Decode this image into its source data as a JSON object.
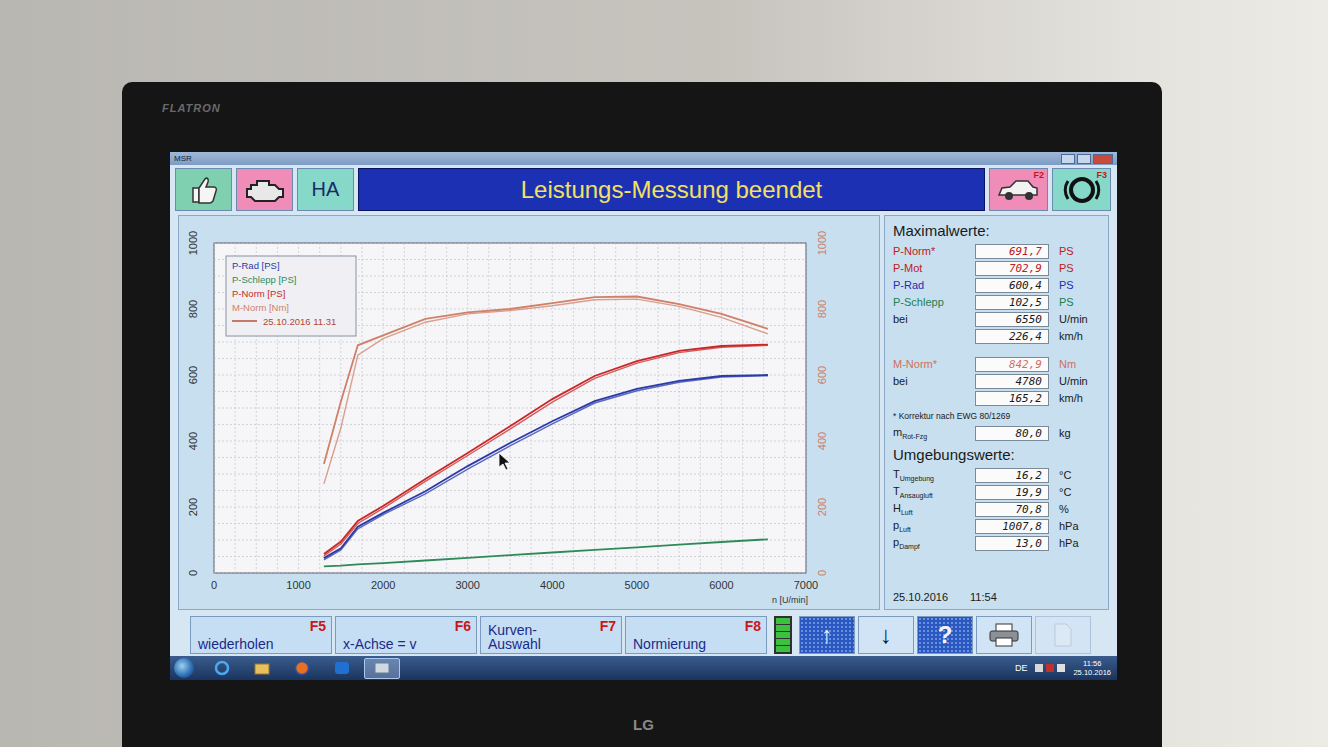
{
  "monitor": {
    "brand": "FLATRON",
    "logo": "LG"
  },
  "window": {
    "title": "MSR"
  },
  "header": {
    "mode": "HA",
    "title": "Leistungs-Messung beendet",
    "f_buttons": [
      {
        "key": "F2",
        "kind": "car"
      },
      {
        "key": "F3",
        "kind": "brake"
      }
    ]
  },
  "chart": {
    "x_ticks": [
      "0",
      "1000",
      "2000",
      "3000",
      "4000",
      "5000",
      "6000",
      "7000"
    ],
    "x_label": "n [U/min]",
    "y_ticks_left": [
      "0",
      "200",
      "400",
      "600",
      "800",
      "1000"
    ],
    "y_ticks_right": [
      "0",
      "200",
      "400",
      "600",
      "800",
      "1000"
    ],
    "rpm": [
      1300,
      1500,
      1700,
      2000,
      2500,
      3000,
      3500,
      4000,
      4500,
      5000,
      5500,
      6000,
      6550
    ],
    "series": [
      {
        "name": "P-Rad [PS]",
        "color": "#2a3aa8",
        "axis": "left",
        "values": [
          45,
          75,
          140,
          182,
          248,
          324,
          394,
          460,
          521,
          558,
          582,
          597,
          600
        ],
        "compare": [
          40,
          70,
          134,
          177,
          240,
          315,
          385,
          452,
          515,
          552,
          578,
          594,
          598
        ]
      },
      {
        "name": "P-Schlepp [PS]",
        "color": "#2f8a58",
        "axis": "left",
        "values": [
          20,
          22,
          26,
          30,
          38,
          46,
          54,
          62,
          70,
          78,
          86,
          94,
          102
        ],
        "compare": []
      },
      {
        "name": "P-Norm [PS]",
        "color": "#c82828",
        "axis": "left",
        "values": [
          58,
          95,
          158,
          203,
          285,
          364,
          445,
          527,
          597,
          642,
          673,
          688,
          692
        ],
        "compare": [
          52,
          88,
          150,
          196,
          278,
          356,
          436,
          518,
          590,
          636,
          668,
          684,
          690
        ]
      },
      {
        "name": "M-Norm [Nm]",
        "color": "#d08068",
        "axis": "right",
        "values": [
          330,
          520,
          690,
          720,
          770,
          790,
          800,
          818,
          836,
          838,
          815,
          785,
          740
        ],
        "compare": [
          270,
          440,
          660,
          710,
          760,
          785,
          795,
          810,
          828,
          830,
          808,
          775,
          725
        ]
      }
    ],
    "compare_label": "25.10.2016 11.31",
    "compare_color": "#b04830"
  },
  "maxima": {
    "title": "Maximalwerte:",
    "rows": [
      {
        "label": "P-Norm*",
        "value": "691,7",
        "unit": "PS",
        "color": "#c02020",
        "highlight": true
      },
      {
        "label": "P-Mot",
        "value": "702,9",
        "unit": "PS",
        "color": "#c02020",
        "highlight": true
      },
      {
        "label": "P-Rad",
        "value": "600,4",
        "unit": "PS",
        "color": "#2030b0",
        "highlight": false
      },
      {
        "label": "P-Schlepp",
        "value": "102,5",
        "unit": "PS",
        "color": "#208050",
        "highlight": false
      },
      {
        "label": "bei",
        "value": "6550",
        "unit": "U/min",
        "color": "#1a1a1a",
        "highlight": false
      },
      {
        "value": "226,4",
        "unit": "km/h",
        "color": "#1a1a1a",
        "highlight": false
      }
    ]
  },
  "torque": {
    "rows": [
      {
        "label": "M-Norm*",
        "value": "842,9",
        "unit": "Nm",
        "color": "#d07060",
        "highlight": true
      },
      {
        "label": "bei",
        "value": "4780",
        "unit": "U/min",
        "color": "#1a1a1a",
        "highlight": false
      },
      {
        "value": "165,2",
        "unit": "km/h",
        "color": "#1a1a1a",
        "highlight": false
      }
    ]
  },
  "note": "* Korrektur nach EWG 80/1269",
  "mass": {
    "label": "m",
    "sub": "Rot-Fzg",
    "value": "80,0",
    "unit": "kg"
  },
  "ambient": {
    "title": "Umgebungswerte:",
    "rows": [
      {
        "label": "T",
        "sub": "Umgebung",
        "value": "16,2",
        "unit": "°C"
      },
      {
        "label": "T",
        "sub": "Ansaugluft",
        "value": "19,9",
        "unit": "°C"
      },
      {
        "label": "H",
        "sub": "Luft",
        "value": "70,8",
        "unit": "%"
      },
      {
        "label": "p",
        "sub": "Luft",
        "value": "1007,8",
        "unit": "hPa"
      },
      {
        "label": "p",
        "sub": "Dampf",
        "value": "13,0",
        "unit": "hPa"
      }
    ]
  },
  "timestamp": {
    "date": "25.10.2016",
    "time": "11:54"
  },
  "function_keys": [
    {
      "lines": [
        "wiederholen"
      ],
      "key": "F5"
    },
    {
      "lines": [
        "x-Achse = v"
      ],
      "key": "F6"
    },
    {
      "lines": [
        "Kurven-",
        "Auswahl"
      ],
      "key": "F7"
    },
    {
      "lines": [
        "Normierung"
      ],
      "key": "F8"
    }
  ],
  "meter": {
    "level": 1
  },
  "tool_buttons": [
    {
      "kind": "glyph",
      "glyph": "↑",
      "highlighted": true,
      "disabled": false
    },
    {
      "kind": "glyph",
      "glyph": "↓",
      "highlighted": false,
      "disabled": false
    },
    {
      "kind": "glyph",
      "glyph": "?",
      "highlighted": true,
      "disabled": false
    },
    {
      "kind": "printer",
      "highlighted": false,
      "disabled": false
    },
    {
      "kind": "file",
      "highlighted": false,
      "disabled": true
    }
  ],
  "taskbar": {
    "apps": [
      {
        "kind": "ie",
        "selected": false
      },
      {
        "kind": "explorer",
        "selected": false
      },
      {
        "kind": "firefox",
        "selected": false
      },
      {
        "kind": "teamviewer",
        "selected": false
      },
      {
        "kind": "msr",
        "selected": true
      }
    ],
    "lang": "DE",
    "time": "11:56",
    "date": "25.10.2016"
  }
}
